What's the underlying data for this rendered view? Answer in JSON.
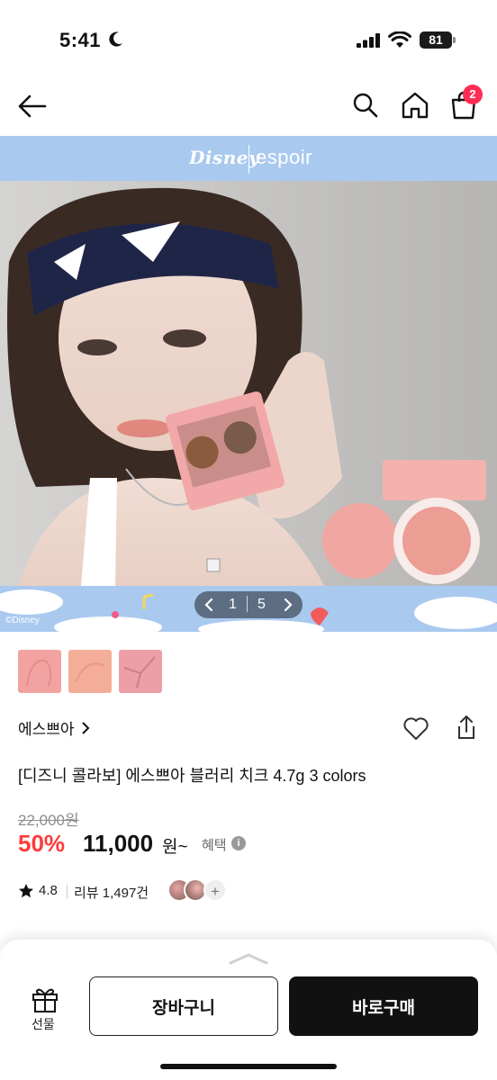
{
  "status_bar": {
    "time": "5:41",
    "battery": "81"
  },
  "nav": {
    "cart_count": "2"
  },
  "hero": {
    "brand_disney": "Disney",
    "brand_espoir": "espoir",
    "copyright": "©Disney",
    "pager_current": "1",
    "pager_total": "5"
  },
  "product": {
    "brand": "에스쁘아",
    "title": "[디즈니 콜라보] 에스쁘아 블러리 치크 4.7g 3 colors",
    "original_price": "22,000원",
    "discount": "50%",
    "price": "11,000",
    "price_suffix": "원~",
    "benefit_label": "혜택",
    "rating": "4.8",
    "reviews": "리뷰 1,497건"
  },
  "bottom_bar": {
    "gift_label": "선물",
    "cart_button": "장바구니",
    "buy_button": "바로구매"
  },
  "colors": {
    "accent_red": "#ff3b3b",
    "badge_pink": "#ff2d55",
    "sky_blue": "#a9c9ef",
    "blush_pink": "#f1a7a1"
  }
}
